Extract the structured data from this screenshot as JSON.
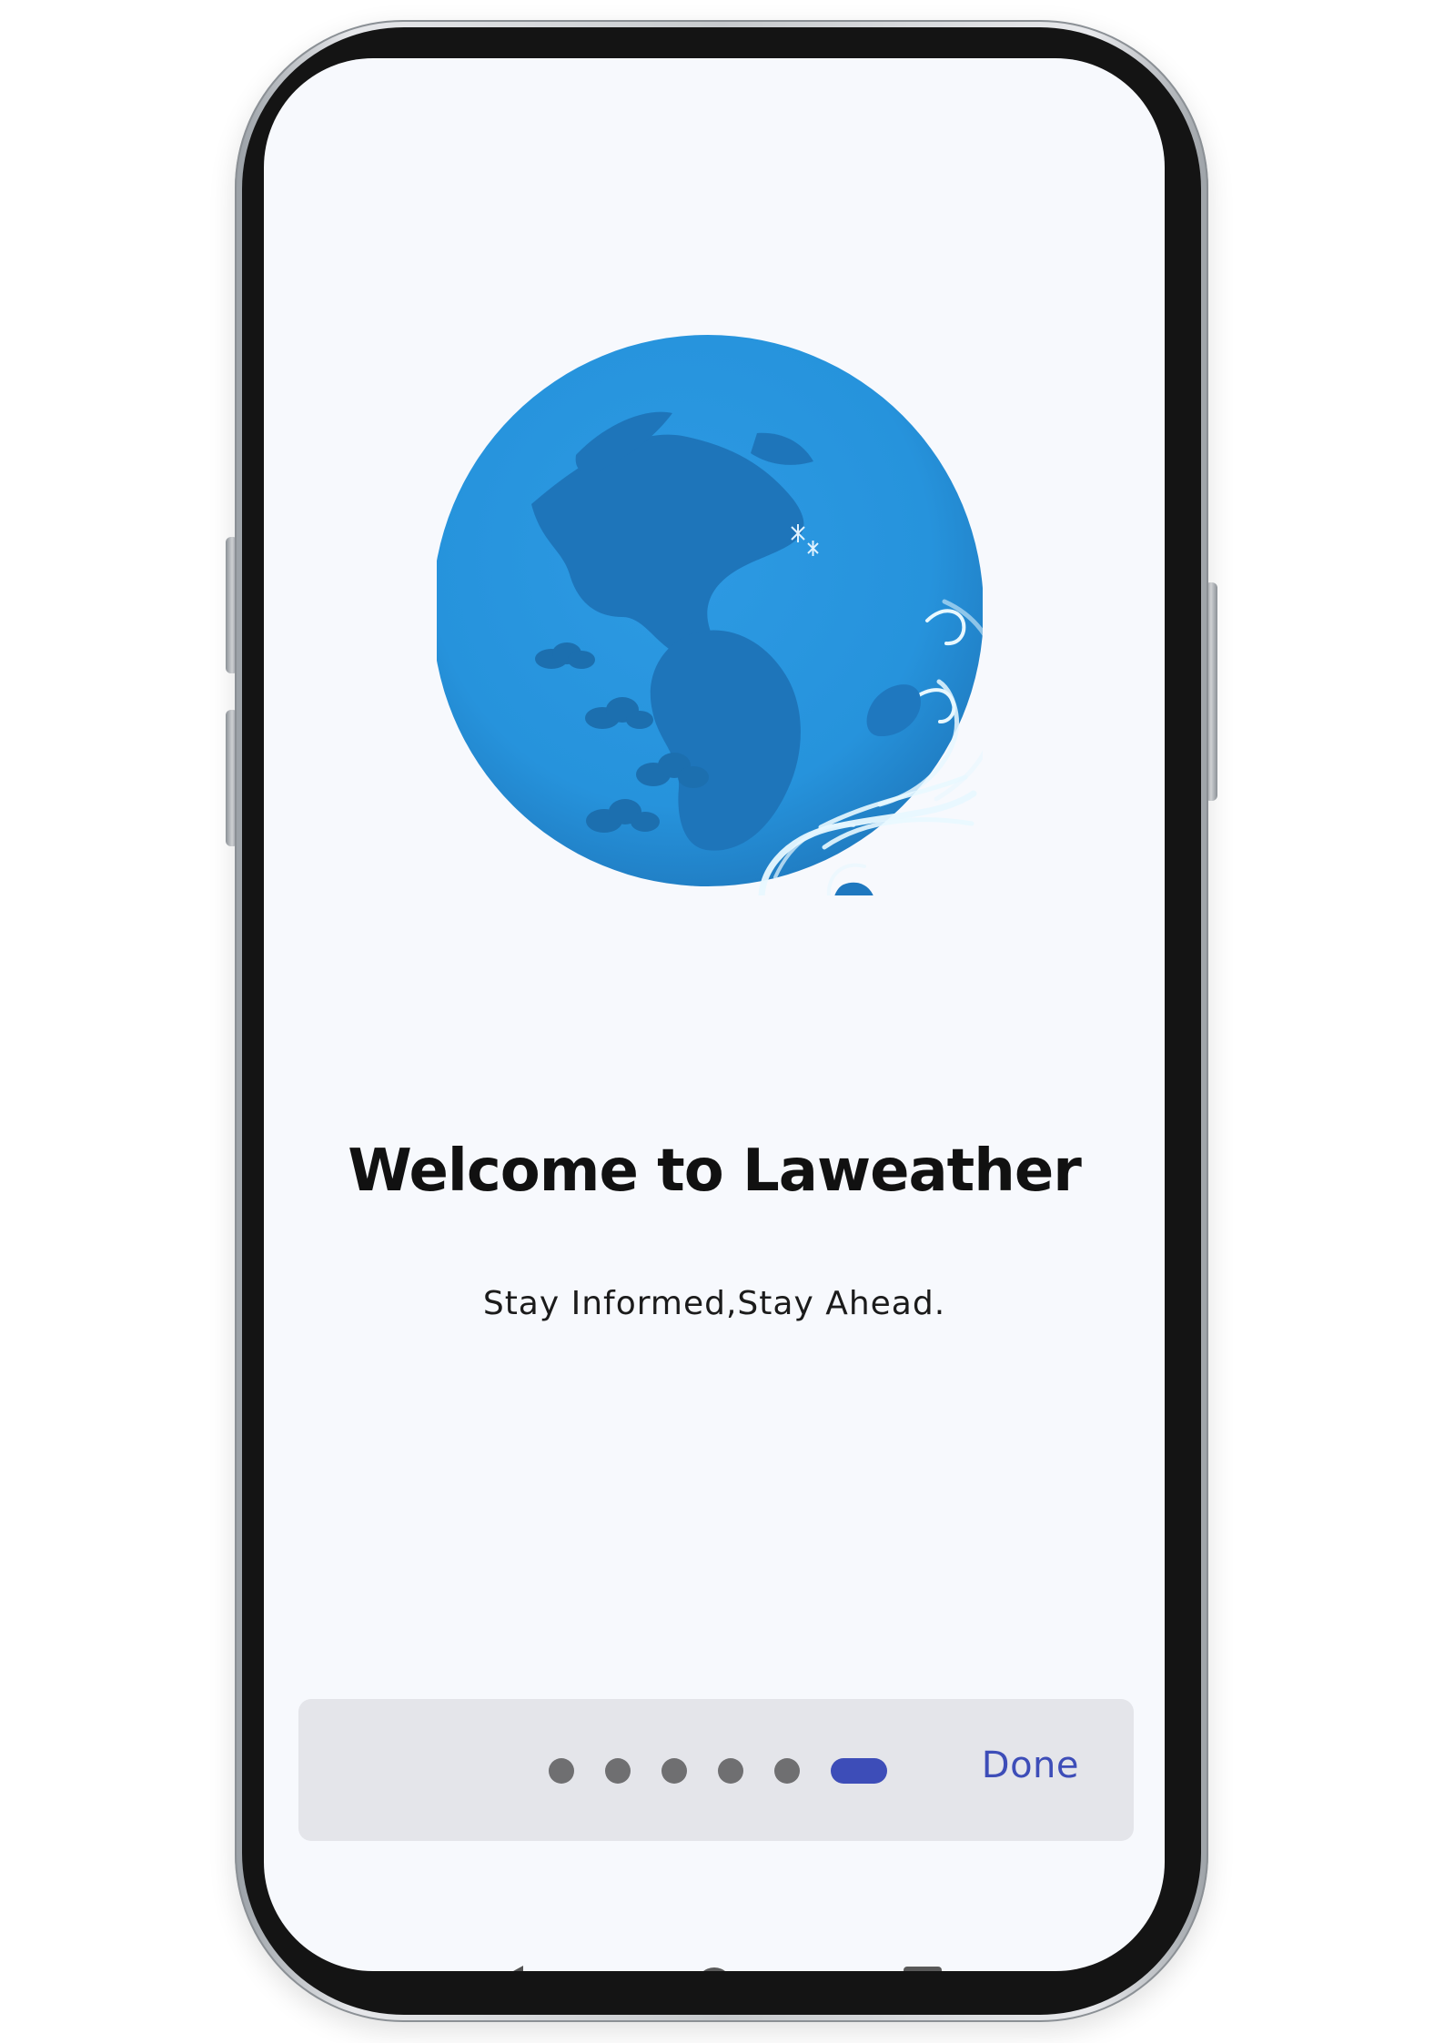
{
  "screen": {
    "title": "Welcome to Laweather",
    "subtitle": "Stay Informed,Stay Ahead."
  },
  "pager": {
    "total_dots": 6,
    "active_index": 5,
    "done_label": "Done"
  },
  "colors": {
    "accent": "#3d4db8",
    "globe_light": "#2795df",
    "globe_dark": "#1d73b7",
    "wind": "#dff4ff",
    "background": "#f7f9fd"
  },
  "icons": {
    "illustration": "globe-icon",
    "back": "back-icon",
    "home": "home-icon",
    "recent": "recent-apps-icon"
  }
}
